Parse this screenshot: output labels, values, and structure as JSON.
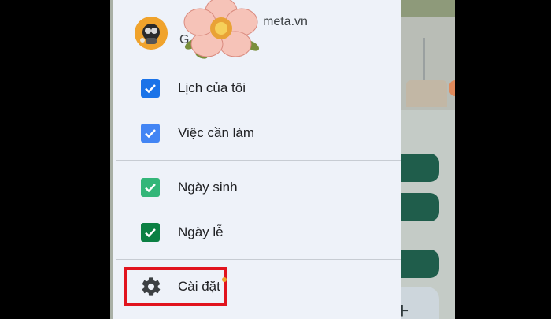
{
  "account": {
    "name": "G",
    "email": "meta.vn"
  },
  "calendars": [
    {
      "label": "Lịch của tôi",
      "checked": true,
      "color": "#1a73e8"
    },
    {
      "label": "Việc cần làm",
      "checked": true,
      "color": "#4285f4"
    },
    {
      "label": "Ngày sinh",
      "checked": true,
      "color": "#33b679"
    },
    {
      "label": "Ngày lễ",
      "checked": true,
      "color": "#0b8043"
    }
  ],
  "settings": {
    "label": "Cài đặt",
    "icon": "gear-icon"
  },
  "colors": {
    "drawer_bg": "#eef2f9",
    "highlight": "#e1141e",
    "event_green": "#1f5d4b"
  },
  "fab": {
    "symbol": "+"
  }
}
